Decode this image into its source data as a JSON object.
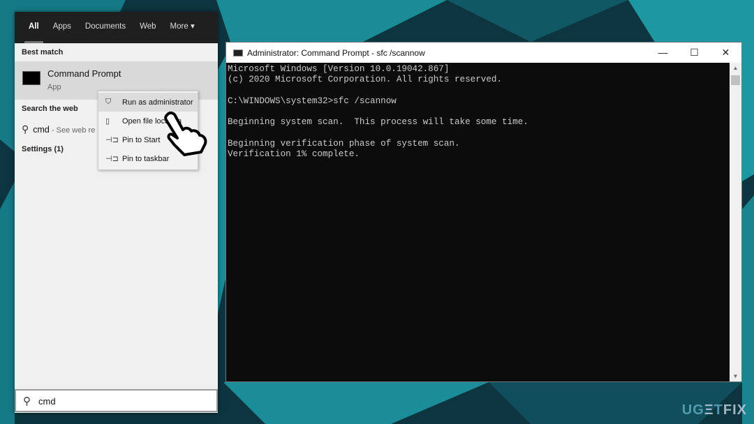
{
  "start_menu": {
    "tabs": [
      {
        "label": "All",
        "active": true
      },
      {
        "label": "Apps"
      },
      {
        "label": "Documents"
      },
      {
        "label": "Web"
      },
      {
        "label": "More ▾"
      }
    ],
    "best_match_label": "Best match",
    "best_match": {
      "title": "Command Prompt",
      "subtitle": "App",
      "icon": "cmd-icon"
    },
    "search_web_label": "Search the web",
    "web_result": {
      "query": "cmd",
      "hint": " - See web re"
    },
    "settings_label": "Settings (1)",
    "search_value": "cmd"
  },
  "context_menu": [
    {
      "label": "Run as administrator",
      "icon": "shield-admin-icon",
      "highlighted": true
    },
    {
      "label": "Open file location",
      "icon": "file-icon"
    },
    {
      "label": "Pin to Start",
      "icon": "pin-icon"
    },
    {
      "label": "Pin to taskbar",
      "icon": "pin-icon"
    }
  ],
  "cmd_window": {
    "title": "Administrator: Command Prompt - sfc  /scannow",
    "output": "Microsoft Windows [Version 10.0.19042.867]\n(c) 2020 Microsoft Corporation. All rights reserved.\n\nC:\\WINDOWS\\system32>sfc /scannow\n\nBeginning system scan.  This process will take some time.\n\nBeginning verification phase of system scan.\nVerification 1% complete."
  },
  "watermark": "UGETFIX",
  "colors": {
    "teal": "#1a8c98",
    "dark": "#0c3a44"
  }
}
